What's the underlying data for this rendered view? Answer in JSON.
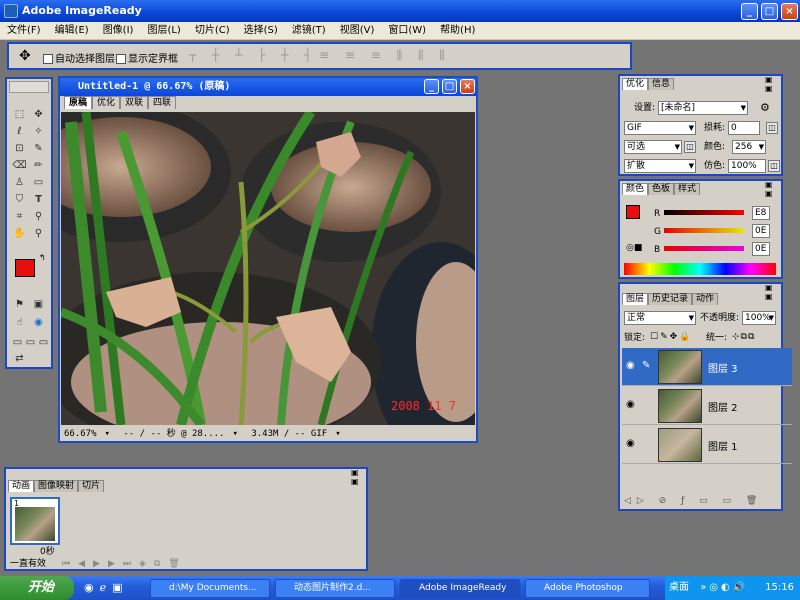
{
  "app": {
    "title": "Adobe ImageReady"
  },
  "menu": [
    "文件(F)",
    "编辑(E)",
    "图像(I)",
    "图层(L)",
    "切片(C)",
    "选择(S)",
    "滤镜(T)",
    "视图(V)",
    "窗口(W)",
    "帮助(H)"
  ],
  "options": {
    "auto_select": "自动选择图层",
    "show_bounds": "显示定界框"
  },
  "document": {
    "title": "Untitled-1 @ 66.67% (原稿)",
    "tabs": [
      "原稿",
      "优化",
      "双联",
      "四联"
    ],
    "date_stamp": "2008 11  7",
    "status": {
      "zoom": "66.67%",
      "time": "-- / -- 秒 @ 28....",
      "size": "3.43M / -- GIF"
    }
  },
  "optimize": {
    "tabs": [
      "优化",
      "信息"
    ],
    "settings_label": "设置:",
    "settings_value": "[未命名]",
    "format": "GIF",
    "lossy_label": "损耗:",
    "lossy_value": "0",
    "palette": "可选",
    "colors_label": "颜色:",
    "colors_value": "256",
    "dither": "扩散",
    "dither_label": "仿色:",
    "dither_value": "100%"
  },
  "color": {
    "tabs": [
      "颜色",
      "色板",
      "样式"
    ],
    "r_label": "R",
    "r_value": "E8",
    "g_label": "G",
    "g_value": "0E",
    "b_label": "B",
    "b_value": "0E"
  },
  "layers": {
    "tabs": [
      "图层",
      "历史记录",
      "动作"
    ],
    "blend": "正常",
    "opacity_label": "不透明度:",
    "opacity_value": "100%",
    "lock_label": "锁定:",
    "unify_label": "统一:",
    "items": [
      {
        "name": "图层 3"
      },
      {
        "name": "图层 2"
      },
      {
        "name": "图层 1"
      }
    ]
  },
  "animation": {
    "tabs": [
      "动画",
      "图像映射",
      "切片"
    ],
    "frame_number": "1",
    "frame_delay": "0秒",
    "loop": "一直有效"
  },
  "taskbar": {
    "start": "开始",
    "tasks": [
      "d:\\My Documents...",
      "动态图片制作2.d...",
      "Adobe ImageReady",
      "Adobe Photoshop"
    ],
    "desktop": "桌面",
    "clock": "15:16"
  },
  "colors": {
    "titlebar": "#0a46d8",
    "foreground": "#e80e0e",
    "panel_border": "#1948c0",
    "selection": "#316ac5"
  }
}
